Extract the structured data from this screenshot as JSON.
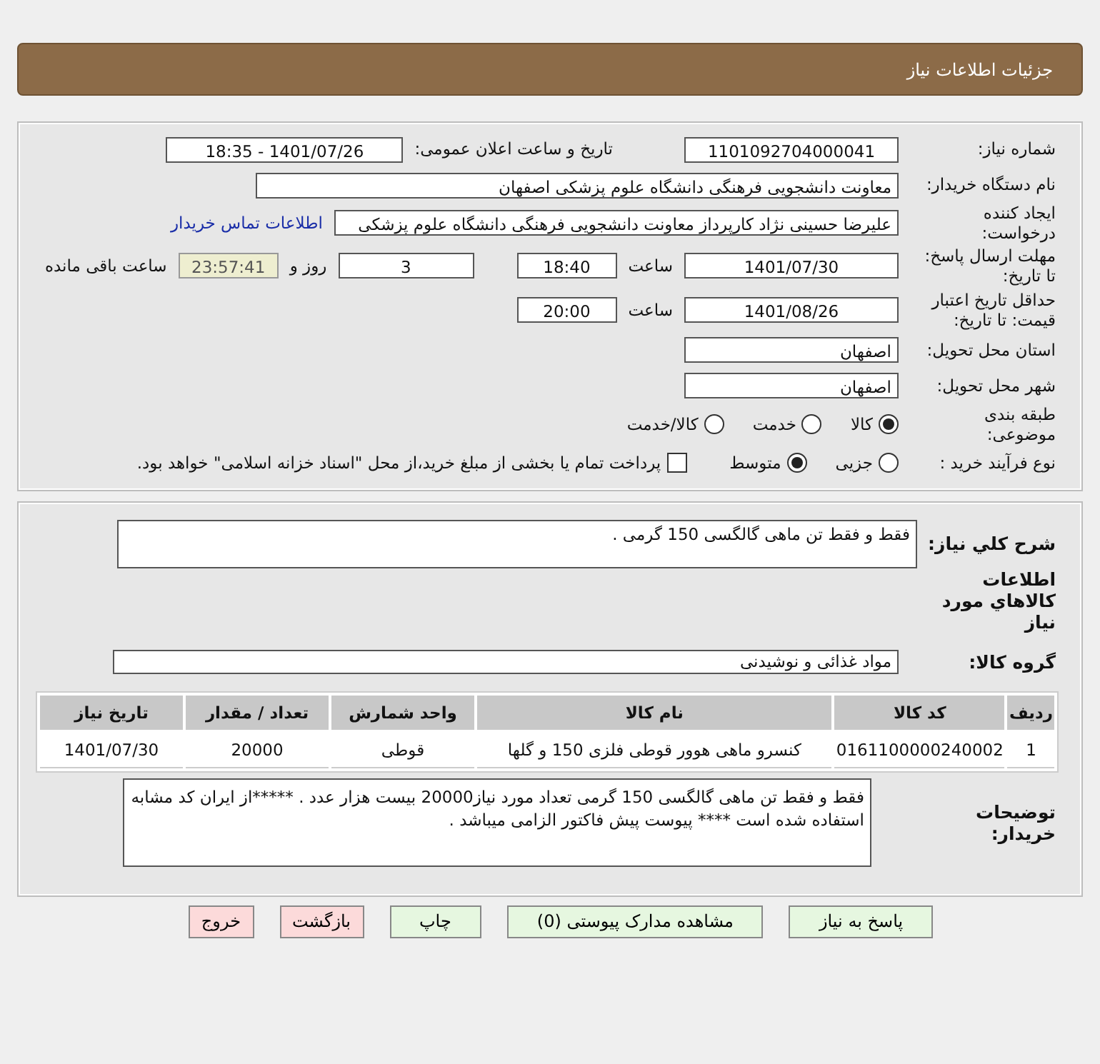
{
  "page": {
    "title": "جزئیات اطلاعات نیاز"
  },
  "details": {
    "need_number": {
      "label": "شماره نیاز:",
      "value": "1101092704000041"
    },
    "announce": {
      "label": "تاریخ و ساعت اعلان عمومی:",
      "value": "1401/07/26 - 18:35"
    },
    "buyer_org": {
      "label": "نام دستگاه خریدار:",
      "value": "معاونت دانشجویی فرهنگی دانشگاه علوم پزشکی اصفهان"
    },
    "requester": {
      "label": "ایجاد کننده درخواست:",
      "value": "علیرضا حسینی نژاد کارپرداز معاونت دانشجویی فرهنگی دانشگاه علوم پزشکی",
      "link": "اطلاعات تماس خریدار"
    },
    "deadline": {
      "label": "مهلت ارسال پاسخ: تا تاریخ:",
      "date": "1401/07/30",
      "time_label": "ساعت",
      "time": "18:40",
      "days": "3",
      "days_label": "روز و",
      "remaining": "23:57:41",
      "remaining_label": "ساعت باقی مانده"
    },
    "validity": {
      "label": "حداقل تاریخ اعتبار قیمت: تا تاریخ:",
      "date": "1401/08/26",
      "time_label": "ساعت",
      "time": "20:00"
    },
    "province": {
      "label": "استان محل تحویل:",
      "value": "اصفهان"
    },
    "city": {
      "label": "شهر محل تحویل:",
      "value": "اصفهان"
    },
    "category": {
      "label": "طبقه بندی موضوعی:",
      "options": [
        {
          "label": "کالا",
          "selected": true
        },
        {
          "label": "خدمت",
          "selected": false
        },
        {
          "label": "کالا/خدمت",
          "selected": false
        }
      ]
    },
    "process": {
      "label": "نوع فرآیند خرید :",
      "options": [
        {
          "label": "جزیی",
          "selected": false
        },
        {
          "label": "متوسط",
          "selected": true
        }
      ],
      "payment": {
        "label": "پرداخت تمام یا بخشی از مبلغ خرید،از محل \"اسناد خزانه اسلامی\" خواهد بود.",
        "checked": false
      }
    }
  },
  "goods": {
    "description": {
      "label": "شرح کلي نياز:",
      "value": "فقط و فقط تن ماهی گالگسی 150 گرمی ."
    },
    "heading": "اطلاعات کالاهاي مورد نياز",
    "group": {
      "label": "گروه کالا:",
      "value": "مواد غذائی و نوشیدنی"
    },
    "table": {
      "columns": [
        "ردیف",
        "کد کالا",
        "نام کالا",
        "واحد شمارش",
        "تعداد / مقدار",
        "تاریخ نیاز"
      ],
      "rows": [
        [
          "1",
          "0161100000240002",
          "کنسرو ماهی هوور قوطی فلزی 150 و گلها",
          "قوطی",
          "20000",
          "1401/07/30"
        ]
      ]
    },
    "notes": {
      "label": "توضیحات خریدار:",
      "value": "فقط و فقط تن ماهی گالگسی 150 گرمی تعداد مورد نیاز20000 بیست هزار عدد . *****از ایران کد مشابه استفاده شده است **** پیوست پیش فاکتور الزامی میباشد ."
    }
  },
  "buttons": [
    {
      "label": "پاسخ به نیاز",
      "kind": "normal"
    },
    {
      "label": "مشاهده مدارک پیوستی (0)",
      "kind": "normal"
    },
    {
      "label": "چاپ",
      "kind": "normal"
    },
    {
      "label": "بازگشت",
      "kind": "danger"
    },
    {
      "label": "خروج",
      "kind": "danger"
    }
  ]
}
